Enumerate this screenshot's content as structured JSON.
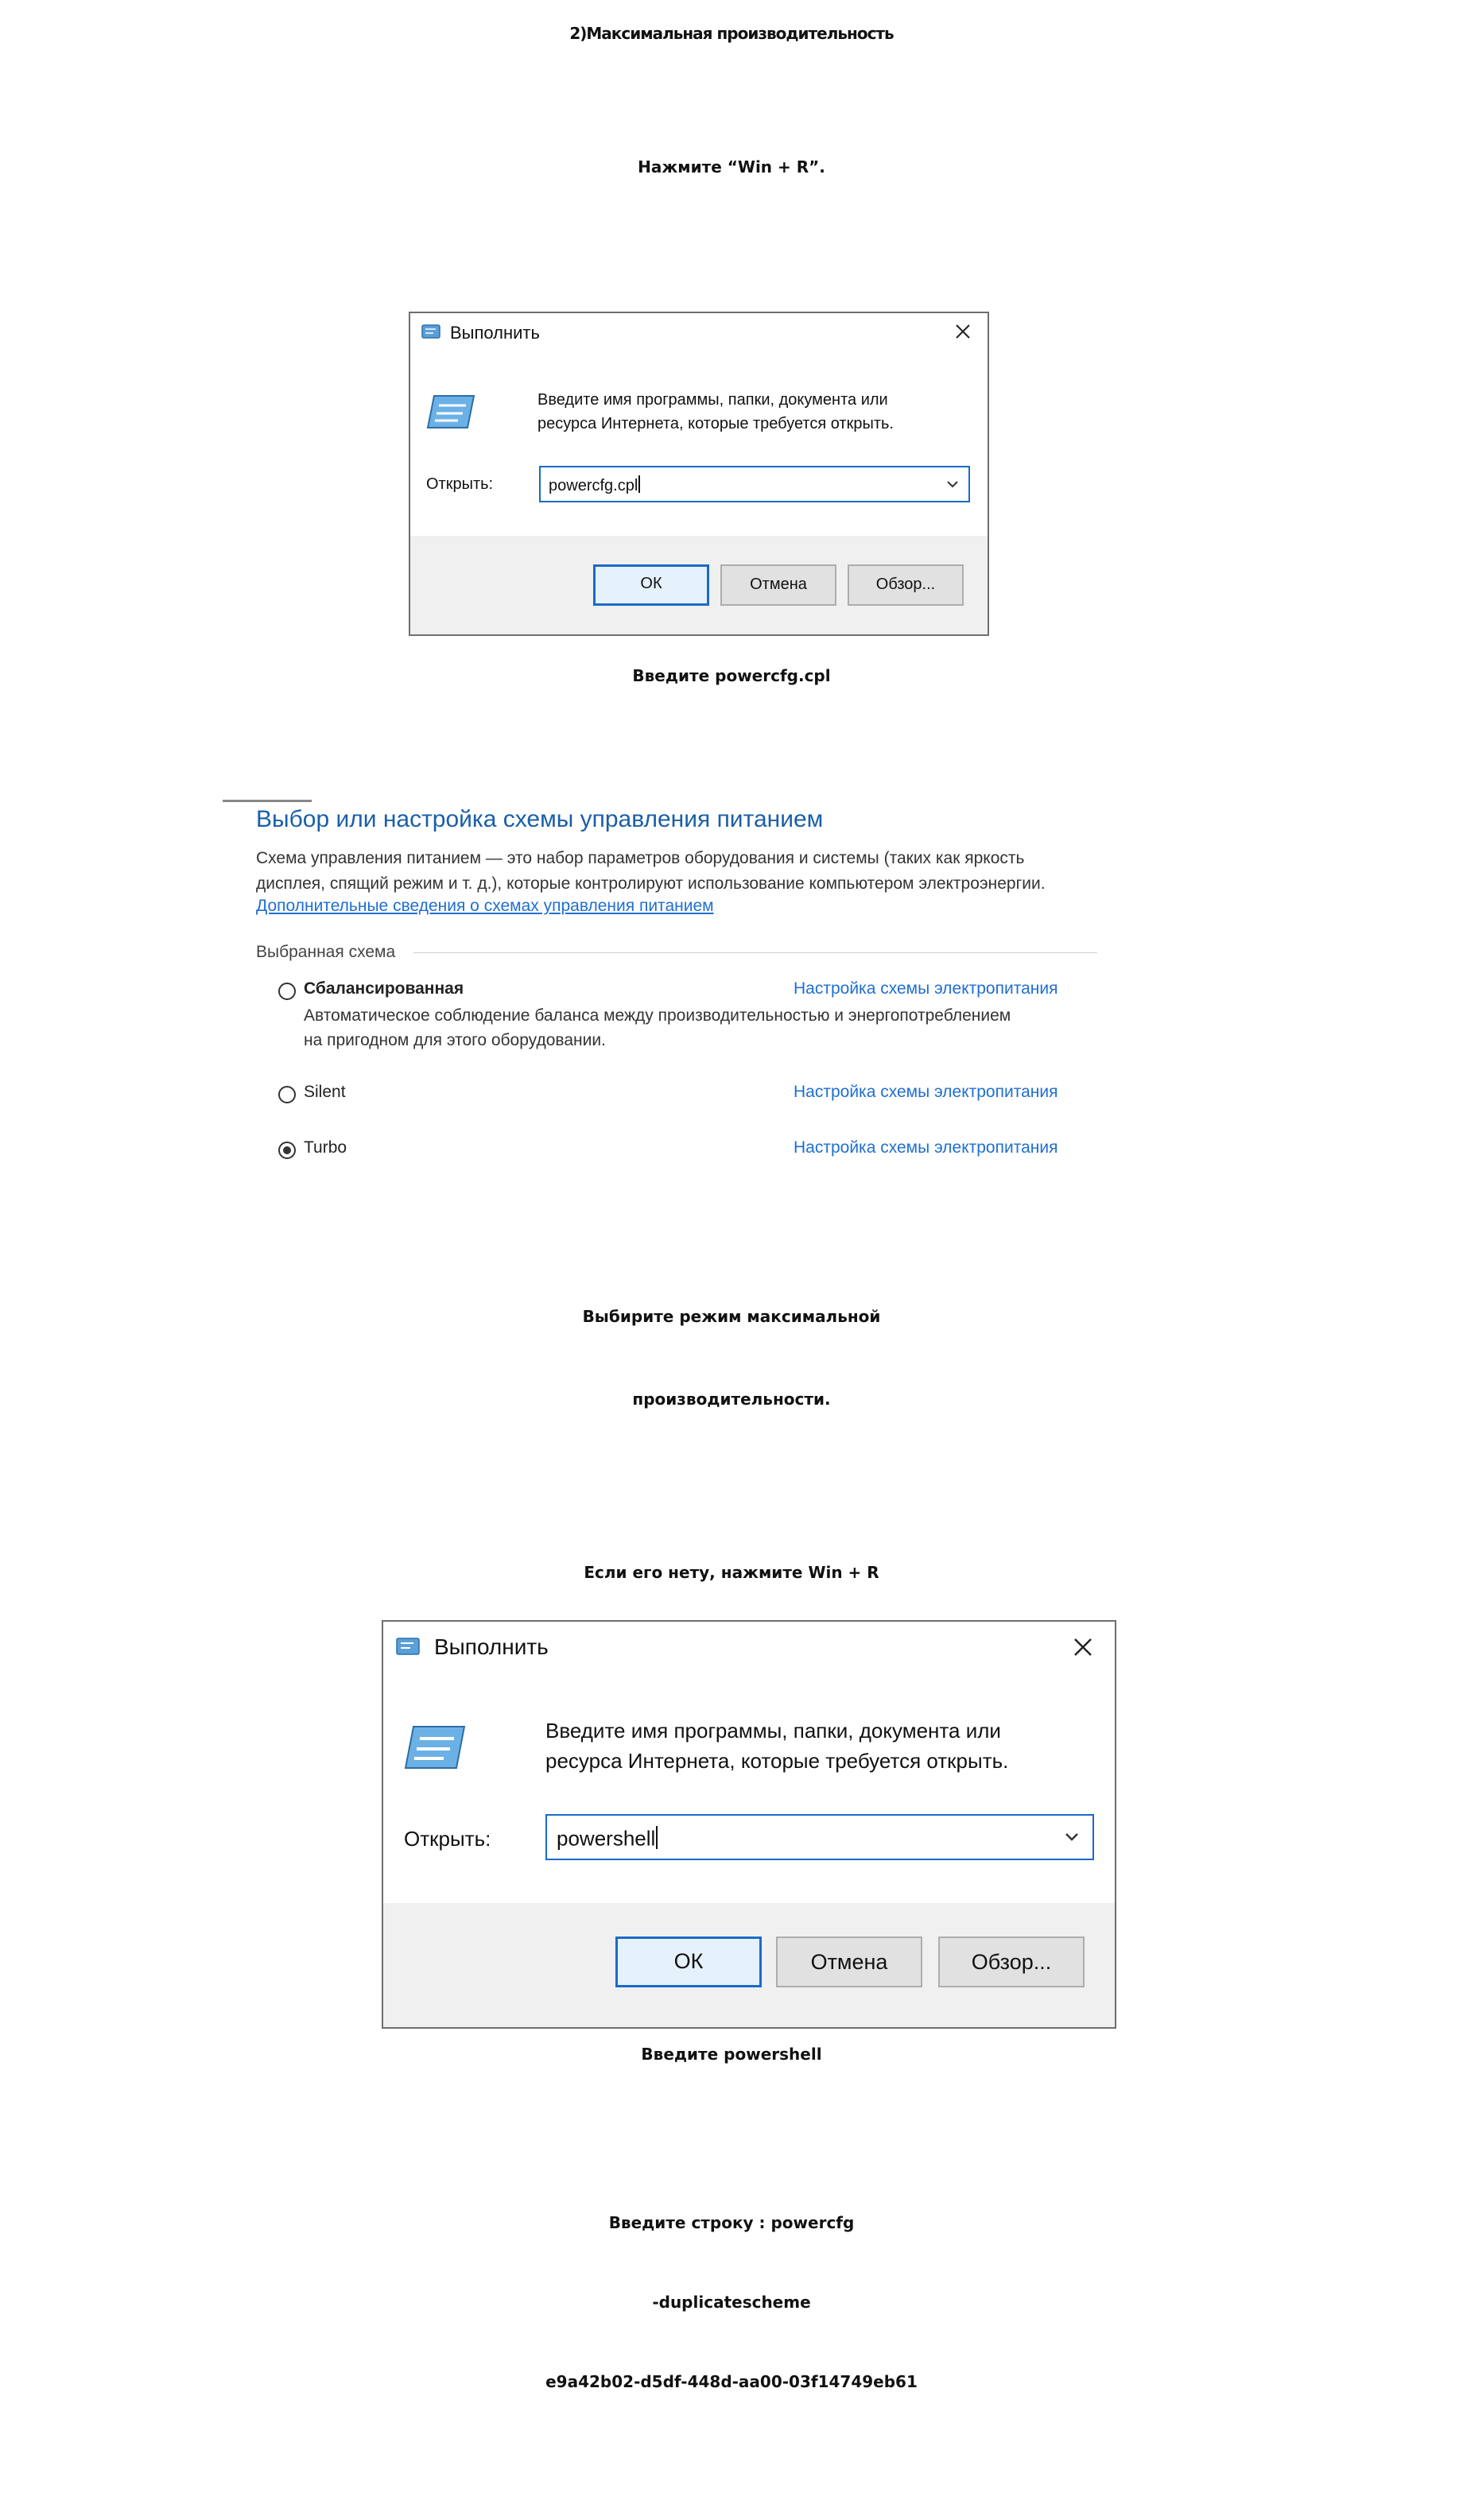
{
  "headings": {
    "h1": "2)Максимальная производительность",
    "h2": "Нажмите “Win + R”.",
    "h3": "Введите powercfg.cpl",
    "h4_line1": "Выбирите режим максимальной",
    "h4_line2": "производительности.",
    "h5": "Если его нету, нажмите Win + R",
    "h6": "Введите powershell",
    "h7_line1": "Введите строку : powercfg",
    "h7_line2": "-duplicatescheme",
    "h7_line3": "e9a42b02-d5df-448d-aa00-03f14749eb61"
  },
  "run_dialog_1": {
    "title": "Выполнить",
    "description_line1": "Введите имя программы, папки, документа или",
    "description_line2": "ресурса Интернета, которые требуется открыть.",
    "open_label": "Открыть:",
    "open_value": "powercfg.cpl",
    "ok_label": "ОК",
    "cancel_label": "Отмена",
    "browse_label": "Обзор..."
  },
  "power_panel": {
    "title": "Выбор или настройка схемы управления питанием",
    "description_line1": "Схема управления питанием — это набор параметров оборудования и системы (таких как яркость",
    "description_line2": "дисплея, спящий режим и т. д.), которые контролируют использование компьютером электроэнергии.",
    "more_info_link": "Дополнительные сведения о схемах управления питанием",
    "section_label": "Выбранная схема",
    "plans": [
      {
        "name": "Сбалансированная",
        "selected": false,
        "desc_line1": "Автоматическое соблюдение баланса между производительностью и энергопотреблением",
        "desc_line2": "на пригодном для этого оборудовании.",
        "settings_link": "Настройка схемы электропитания"
      },
      {
        "name": "Silent",
        "selected": false,
        "settings_link": "Настройка схемы электропитания"
      },
      {
        "name": "Turbo",
        "selected": true,
        "settings_link": "Настройка схемы электропитания"
      }
    ]
  },
  "run_dialog_2": {
    "title": "Выполнить",
    "description_line1": "Введите имя программы, папки, документа или",
    "description_line2": "ресурса Интернета, которые требуется открыть.",
    "open_label": "Открыть:",
    "open_value": "powershell",
    "ok_label": "ОК",
    "cancel_label": "Отмена",
    "browse_label": "Обзор..."
  },
  "colors": {
    "accent_blue": "#1b6ac9",
    "link_blue": "#1f6fd1",
    "panel_title_blue": "#1a5fa8",
    "footer_gray": "#f0f0f0"
  },
  "icons": [
    "run-app-icon",
    "close-icon",
    "run-program-icon",
    "chevron-down-icon",
    "radio-icon"
  ]
}
